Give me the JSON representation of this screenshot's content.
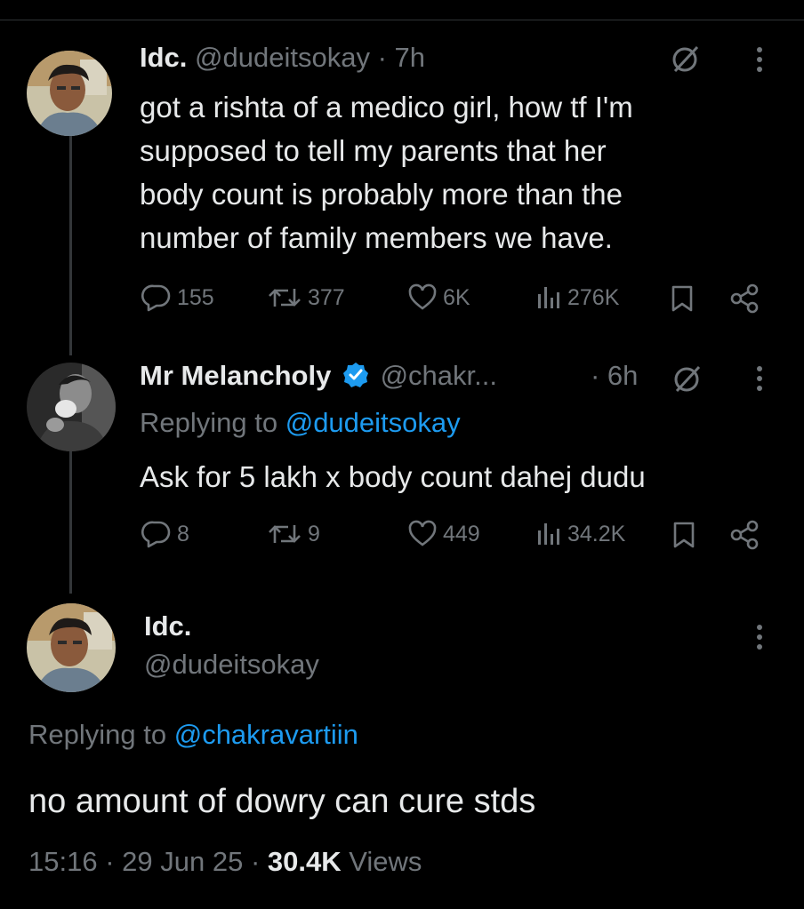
{
  "tweet1": {
    "display_name": "Idc.",
    "handle": "@dudeitsokay",
    "time": "· 7h",
    "text": [
      "got a rishta of a medico girl, how tf I'm",
      "supposed to tell my parents that her",
      "body count is probably more than the",
      "number of family members we have."
    ],
    "replies": "155",
    "reposts": "377",
    "likes": "6K",
    "views": "276K"
  },
  "tweet2": {
    "display_name": "Mr Melancholy",
    "handle": "@chakr...",
    "time": "· 6h",
    "replying_prefix": "Replying to",
    "replying_handle": "@dudeitsokay",
    "text": "Ask for 5 lakh x body count dahej dudu",
    "replies": "8",
    "reposts": "9",
    "likes": "449",
    "views": "34.2K"
  },
  "tweet3": {
    "display_name": "Idc.",
    "handle": "@dudeitsokay",
    "replying_prefix": "Replying to",
    "replying_handle": "@chakravartiin",
    "text": "no amount of dowry can cure stds",
    "time": "15:16",
    "date": "29 Jun 25",
    "views_count": "30.4K",
    "views_label": "Views"
  },
  "colors": {
    "background": "#000000",
    "text": "#e7e9ea",
    "muted": "#71767b",
    "accent": "#1d9bf0"
  }
}
